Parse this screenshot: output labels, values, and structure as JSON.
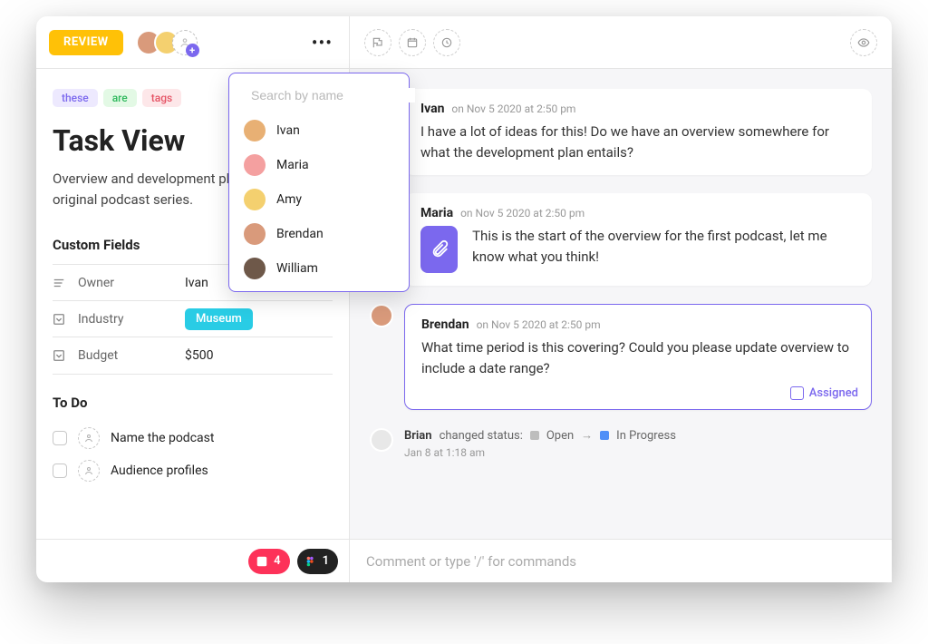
{
  "header": {
    "review_label": "REVIEW"
  },
  "search_dropdown": {
    "placeholder": "Search by name",
    "items": [
      "Ivan",
      "Maria",
      "Amy",
      "Brendan",
      "William"
    ]
  },
  "tags": [
    "these",
    "are",
    "tags"
  ],
  "task": {
    "title": "Task View",
    "description": "Overview and development plan for the first original podcast series."
  },
  "sections": {
    "custom_fields": "Custom Fields",
    "todo": "To Do"
  },
  "fields": [
    {
      "label": "Owner",
      "value": "Ivan",
      "style": "text"
    },
    {
      "label": "Industry",
      "value": "Museum",
      "style": "pill"
    },
    {
      "label": "Budget",
      "value": "$500",
      "style": "text"
    }
  ],
  "todos": [
    "Name the podcast",
    "Audience profiles"
  ],
  "left_footer": {
    "pink_count": "4",
    "dark_count": "1"
  },
  "activity": {
    "c1": {
      "author": "Ivan",
      "time": "on Nov 5 2020 at 2:50 pm",
      "body": "I have a lot of ideas for this! Do we have an overview somewhere for what the development plan entails?"
    },
    "c2": {
      "author": "Maria",
      "time": "on Nov 5 2020 at 2:50 pm",
      "body": "This is the start of the overview for the first podcast, let me know what you think!"
    },
    "c3": {
      "author": "Brendan",
      "time": "on Nov 5 2020 at 2:50 pm",
      "body": "What time period is this covering? Could you please update overview to include a date range?",
      "assigned_label": "Assigned"
    },
    "status": {
      "actor": "Brian",
      "verb": "changed status:",
      "from": "Open",
      "to": "In Progress",
      "time": "Jan 8 at 1:18 am"
    }
  },
  "comment_placeholder": "Comment or type '/' for commands"
}
